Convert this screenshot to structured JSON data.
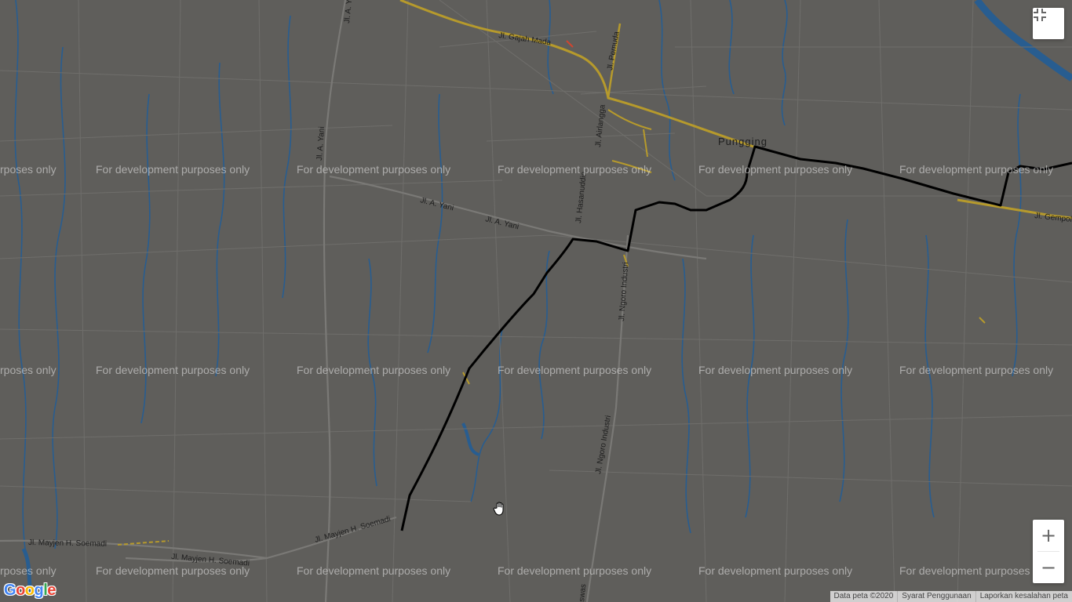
{
  "map": {
    "place_labels": {
      "town": "Pungging",
      "gajah_mada": "Jl. Gajah Mada",
      "pemuda": "Jl. Pemuda",
      "airlangga": "Jl. Airlangga",
      "hasanuddin": "Jl. Hasanuddin",
      "a_yani_v_top": "Jl. A. Yani",
      "a_yani_v": "Jl. A. Yani",
      "a_yani_1": "Jl. A. Yani",
      "a_yani_2": "Jl. A. Yani",
      "ngoro_1": "Jl. Ngoro Industri",
      "ngoro_2": "Jl. Ngoro Industri",
      "gempol": "Jl. Gempol",
      "soemadi_1": "Jl. Mayjen H. Soemadi",
      "soemadi_2": "Jl. Mayjen H. Soemadi",
      "soemadi_3": "Jl. Mayjen H. Soemadi",
      "bottom": "swas"
    },
    "watermark": "For development purposes only",
    "watermark_edge": "rposes only",
    "colors": {
      "land": "#5f5e5b",
      "road_minor": "#6f6e6b",
      "water": "#1f5d9a",
      "highway": "#b69a2c",
      "route": "#000000"
    }
  },
  "controls": {
    "fullscreen_icon": "fullscreen-exit-icon",
    "zoom_in": "+",
    "zoom_out": "−"
  },
  "attribution": {
    "data": "Data peta ©2020",
    "terms": "Syarat Penggunaan",
    "report": "Laporkan kesalahan peta"
  },
  "logo": {
    "letters": [
      "G",
      "o",
      "o",
      "g",
      "l",
      "e"
    ],
    "colors": [
      "#4285f4",
      "#ea4335",
      "#fbbc05",
      "#4285f4",
      "#34a853",
      "#ea4335"
    ]
  }
}
